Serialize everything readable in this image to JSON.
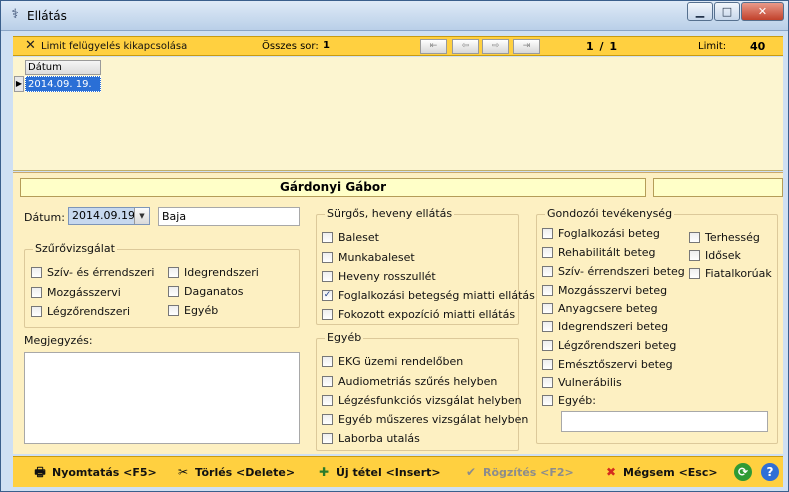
{
  "window": {
    "title": "Ellátás",
    "minimize": "▁",
    "maximize": "□",
    "close": "✕"
  },
  "toolbar": {
    "limit_off_label": "Limit felügyelés kikapcsolása",
    "total_rows_label": "Összes sor:",
    "total_rows": "1",
    "page": "1 / 1",
    "limit_label": "Limit:",
    "limit": "40",
    "nav_icons": [
      "first-icon",
      "prev-icon",
      "next-icon",
      "last-icon"
    ]
  },
  "grid": {
    "header": "Dátum",
    "rows": [
      "2014.09. 19."
    ]
  },
  "patient": {
    "name": "Gárdonyi Gábor"
  },
  "form": {
    "date_label": "Dátum:",
    "date_value": "2014.09.19",
    "place_value": "Baja",
    "screening": {
      "title": "Szűrővizsgálat",
      "items": [
        {
          "label": "Szív- és érrendszeri",
          "checked": false
        },
        {
          "label": "Mozgásszervi",
          "checked": false
        },
        {
          "label": "Légzőrendszeri",
          "checked": false
        },
        {
          "label": "Idegrendszeri",
          "checked": false
        },
        {
          "label": "Daganatos",
          "checked": false
        },
        {
          "label": "Egyéb",
          "checked": false
        }
      ]
    },
    "notes_label": "Megjegyzés:",
    "urgent": {
      "title": "Sürgős, heveny ellátás",
      "items": [
        {
          "label": "Baleset",
          "checked": false
        },
        {
          "label": "Munkabaleset",
          "checked": false
        },
        {
          "label": "Heveny rosszullét",
          "checked": false
        },
        {
          "label": "Foglalkozási betegség miatti ellátás",
          "checked": true
        },
        {
          "label": "Fokozott expozíció miatti ellátás",
          "checked": false
        }
      ]
    },
    "other": {
      "title": "Egyéb",
      "items": [
        {
          "label": "EKG üzemi rendelőben",
          "checked": false
        },
        {
          "label": "Audiometriás szűrés helyben",
          "checked": false
        },
        {
          "label": "Légzésfunkciós vizsgálat helyben",
          "checked": false
        },
        {
          "label": "Egyéb műszeres vizsgálat helyben",
          "checked": false
        },
        {
          "label": "Laborba utalás",
          "checked": false
        }
      ]
    },
    "care": {
      "title": "Gondozói tevékenység",
      "items": [
        {
          "label": "Foglalkozási beteg",
          "checked": false
        },
        {
          "label": "Rehabilitált beteg",
          "checked": false
        },
        {
          "label": "Szív- érrendszeri beteg",
          "checked": false
        },
        {
          "label": "Mozgásszervi beteg",
          "checked": false
        },
        {
          "label": "Anyagcsere beteg",
          "checked": false
        },
        {
          "label": "Idegrendszeri beteg",
          "checked": false
        },
        {
          "label": "Légzőrendszeri beteg",
          "checked": false
        },
        {
          "label": "Emésztőszervi beteg",
          "checked": false
        },
        {
          "label": "Vulnerábilis",
          "checked": false
        },
        {
          "label": "Egyéb:",
          "checked": false
        }
      ],
      "right_items": [
        {
          "label": "Terhesség",
          "checked": false
        },
        {
          "label": "Idősek",
          "checked": false
        },
        {
          "label": "Fiatalkorúak",
          "checked": false
        }
      ]
    }
  },
  "bottom": {
    "print": "Nyomtatás <F5>",
    "delete": "Törlés <Delete>",
    "new": "Új tétel <Insert>",
    "save": "Rögzítés <F2>",
    "cancel": "Mégsem <Esc>",
    "refresh_icon": "refresh-icon",
    "help_icon": "help-icon"
  },
  "colors": {
    "accent_bar": "#ffd040",
    "form_bg": "#fdf0c2",
    "selection": "#2a6fd6"
  }
}
